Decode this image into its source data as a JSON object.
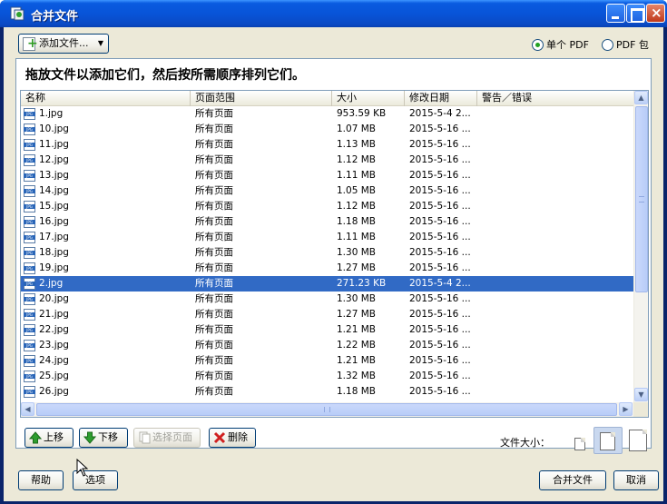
{
  "window": {
    "title": "合并文件",
    "colors": {
      "titlebar": "#0a5be0",
      "selection": "#316ac5",
      "close": "#c0391b"
    }
  },
  "toolbar": {
    "add_files_label": "添加文件...",
    "radio_single_pdf": "单个 PDF",
    "radio_pdf_package": "PDF 包",
    "selected_option": "单个 PDF"
  },
  "instruction": "拖放文件以添加它们，然后按所需顺序排列它们。",
  "columns": [
    "名称",
    "页面范围",
    "大小",
    "修改日期",
    "警告／错误"
  ],
  "rows": [
    {
      "name": "1.jpg",
      "range": "所有页面",
      "size": "953.59 KB",
      "date": "2015-5-4 2...",
      "selected": false
    },
    {
      "name": "10.jpg",
      "range": "所有页面",
      "size": "1.07 MB",
      "date": "2015-5-16 ...",
      "selected": false
    },
    {
      "name": "11.jpg",
      "range": "所有页面",
      "size": "1.13 MB",
      "date": "2015-5-16 ...",
      "selected": false
    },
    {
      "name": "12.jpg",
      "range": "所有页面",
      "size": "1.12 MB",
      "date": "2015-5-16 ...",
      "selected": false
    },
    {
      "name": "13.jpg",
      "range": "所有页面",
      "size": "1.11 MB",
      "date": "2015-5-16 ...",
      "selected": false
    },
    {
      "name": "14.jpg",
      "range": "所有页面",
      "size": "1.05 MB",
      "date": "2015-5-16 ...",
      "selected": false
    },
    {
      "name": "15.jpg",
      "range": "所有页面",
      "size": "1.12 MB",
      "date": "2015-5-16 ...",
      "selected": false
    },
    {
      "name": "16.jpg",
      "range": "所有页面",
      "size": "1.18 MB",
      "date": "2015-5-16 ...",
      "selected": false
    },
    {
      "name": "17.jpg",
      "range": "所有页面",
      "size": "1.11 MB",
      "date": "2015-5-16 ...",
      "selected": false
    },
    {
      "name": "18.jpg",
      "range": "所有页面",
      "size": "1.30 MB",
      "date": "2015-5-16 ...",
      "selected": false
    },
    {
      "name": "19.jpg",
      "range": "所有页面",
      "size": "1.27 MB",
      "date": "2015-5-16 ...",
      "selected": false
    },
    {
      "name": "2.jpg",
      "range": "所有页面",
      "size": "271.23 KB",
      "date": "2015-5-4 2...",
      "selected": true
    },
    {
      "name": "20.jpg",
      "range": "所有页面",
      "size": "1.30 MB",
      "date": "2015-5-16 ...",
      "selected": false
    },
    {
      "name": "21.jpg",
      "range": "所有页面",
      "size": "1.27 MB",
      "date": "2015-5-16 ...",
      "selected": false
    },
    {
      "name": "22.jpg",
      "range": "所有页面",
      "size": "1.21 MB",
      "date": "2015-5-16 ...",
      "selected": false
    },
    {
      "name": "23.jpg",
      "range": "所有页面",
      "size": "1.22 MB",
      "date": "2015-5-16 ...",
      "selected": false
    },
    {
      "name": "24.jpg",
      "range": "所有页面",
      "size": "1.21 MB",
      "date": "2015-5-16 ...",
      "selected": false
    },
    {
      "name": "25.jpg",
      "range": "所有页面",
      "size": "1.32 MB",
      "date": "2015-5-16 ...",
      "selected": false
    },
    {
      "name": "26.jpg",
      "range": "所有页面",
      "size": "1.18 MB",
      "date": "2015-5-16 ...",
      "selected": false
    }
  ],
  "actions": {
    "move_up": "上移",
    "move_down": "下移",
    "choose_pages": "选择页面",
    "delete": "删除",
    "file_size_label": "文件大小："
  },
  "footer": {
    "help": "帮助",
    "options": "选项",
    "combine": "合并文件",
    "cancel": "取消"
  }
}
